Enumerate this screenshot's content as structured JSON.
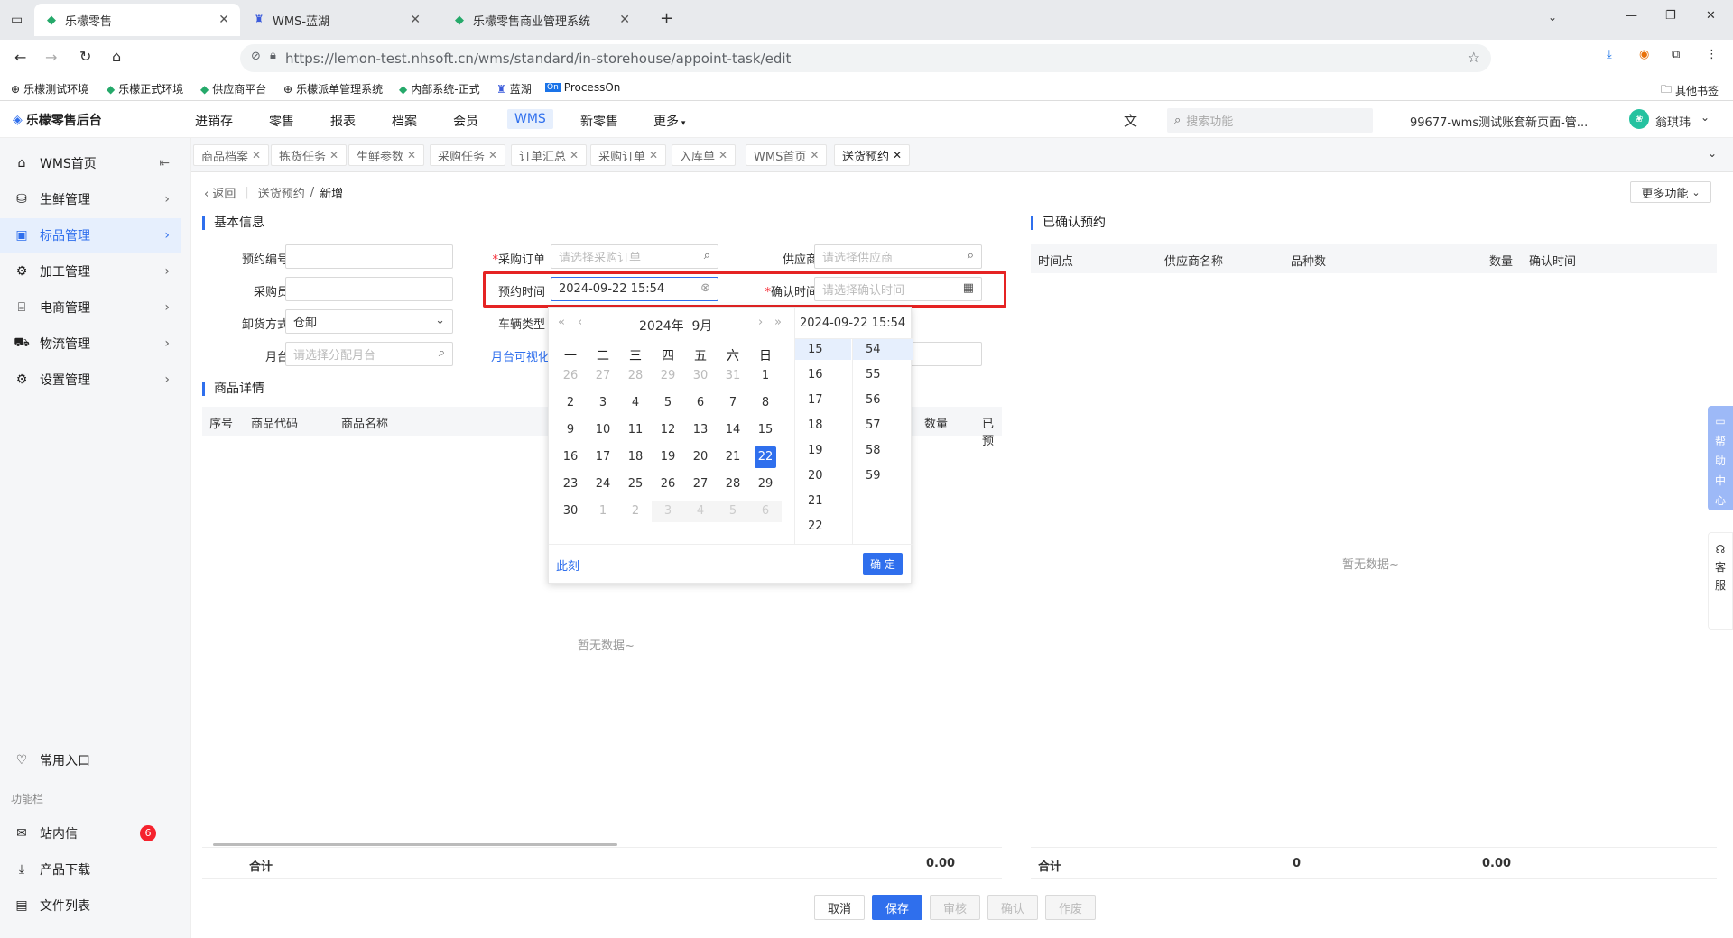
{
  "browser": {
    "tabs": [
      {
        "title": "乐檬零售",
        "active": true
      },
      {
        "title": "WMS-蓝湖",
        "active": false
      },
      {
        "title": "乐檬零售商业管理系统",
        "active": false
      }
    ],
    "url": "https://lemon-test.nhsoft.cn/wms/standard/in-storehouse/appoint-task/edit",
    "bookmarks": [
      "乐檬测试环境",
      "乐檬正式环境",
      "供应商平台",
      "乐檬派单管理系统",
      "内部系统-正式",
      "蓝湖",
      "ProcessOn"
    ],
    "other_bookmarks": "其他书签"
  },
  "app": {
    "logo": "乐檬零售后台",
    "nav": [
      "进销存",
      "零售",
      "报表",
      "档案",
      "会员",
      "WMS",
      "新零售",
      "更多"
    ],
    "active_nav": "WMS",
    "search_placeholder": "搜索功能",
    "account": "99677-wms测试账套新页面-管...",
    "user": "翁琪玮"
  },
  "sidebar": {
    "items": [
      "WMS首页",
      "生鲜管理",
      "标品管理",
      "加工管理",
      "电商管理",
      "物流管理",
      "设置管理"
    ],
    "active": "标品管理",
    "common_entry": "常用入口",
    "section": "功能栏",
    "messages": "站内信",
    "messages_badge": "6",
    "downloads": "产品下载",
    "files": "文件列表"
  },
  "page_tabs": [
    "商品档案",
    "拣货任务",
    "生鲜参数",
    "采购任务",
    "订单汇总",
    "采购订单",
    "入库单",
    "WMS首页",
    "送货预约"
  ],
  "active_page_tab": "送货预约",
  "breadcrumb": {
    "back": "返回",
    "parent": "送货预约",
    "current": "新增"
  },
  "more_functions": "更多功能",
  "basic_info": {
    "title": "基本信息",
    "appoint_no_label": "预约编号",
    "purchase_order_label": "采购订单",
    "purchase_order_placeholder": "请选择采购订单",
    "supplier_label": "供应商",
    "supplier_placeholder": "请选择供应商",
    "buyer_label": "采购员",
    "appoint_time_label": "预约时间",
    "appoint_time_value": "2024-09-22 15:54",
    "confirm_time_label": "确认时间",
    "confirm_time_placeholder": "请选择确认时间",
    "unload_label": "卸货方式",
    "unload_value": "仓卸",
    "vehicle_label": "车辆类型",
    "dock_label": "月台",
    "dock_placeholder": "请选择分配月台",
    "dock_link": "月台可视化"
  },
  "goods": {
    "title": "商品详情",
    "columns": [
      "序号",
      "商品代码",
      "商品名称",
      "数量",
      "已预"
    ],
    "empty": "暂无数据~",
    "total_label": "合计",
    "total_value": "0.00"
  },
  "confirmed": {
    "title": "已确认预约",
    "columns": [
      "时间点",
      "供应商名称",
      "品种数",
      "数量",
      "确认时间"
    ],
    "empty": "暂无数据~",
    "total_label": "合计",
    "total_count": "0",
    "total_value": "0.00"
  },
  "calendar": {
    "year_month": "2024年  9月",
    "selected_display": "2024-09-22 15:54",
    "weekdays": [
      "一",
      "二",
      "三",
      "四",
      "五",
      "六",
      "日"
    ],
    "weeks": [
      [
        "26",
        "27",
        "28",
        "29",
        "30",
        "31",
        "1"
      ],
      [
        "2",
        "3",
        "4",
        "5",
        "6",
        "7",
        "8"
      ],
      [
        "9",
        "10",
        "11",
        "12",
        "13",
        "14",
        "15"
      ],
      [
        "16",
        "17",
        "18",
        "19",
        "20",
        "21",
        "22"
      ],
      [
        "23",
        "24",
        "25",
        "26",
        "27",
        "28",
        "29"
      ],
      [
        "30",
        "1",
        "2",
        "3",
        "4",
        "5",
        "6"
      ]
    ],
    "selected_day": "22",
    "hours": [
      "15",
      "16",
      "17",
      "18",
      "19",
      "20",
      "21",
      "22"
    ],
    "minutes": [
      "54",
      "55",
      "56",
      "57",
      "58",
      "59"
    ],
    "now": "此刻",
    "ok": "确 定"
  },
  "help": {
    "help_center": "帮助中心",
    "service": "客服"
  },
  "footer_buttons": {
    "cancel": "取消",
    "save": "保存",
    "audit": "审核",
    "confirm": "确认",
    "void": "作废"
  }
}
